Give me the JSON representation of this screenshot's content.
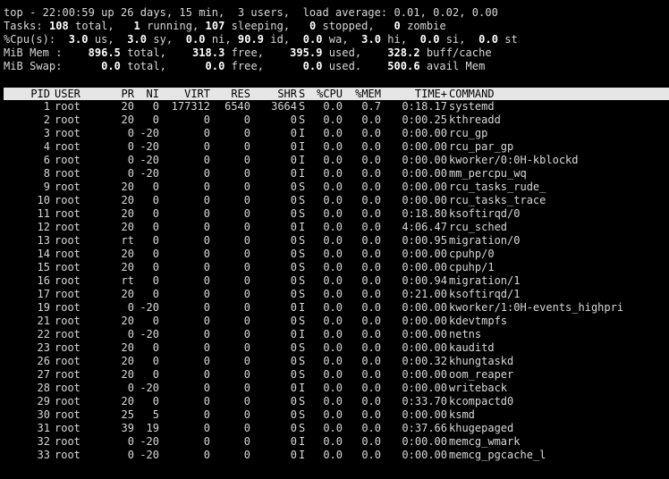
{
  "summary": {
    "uptime": {
      "prefix": "top - 22:00:59 up 26 days, 15 min,  3 users,  load average: 0.01, 0.02, 0.00"
    },
    "tasks": {
      "label": "Tasks: ",
      "total": "108",
      "total_label": " total,   ",
      "running": "1",
      "running_label": " running, ",
      "sleeping": "107",
      "sleeping_label": " sleeping,   ",
      "stopped": "0",
      "stopped_label": " stopped,   ",
      "zombie": "0",
      "zombie_label": " zombie"
    },
    "cpu": {
      "label": "%Cpu(s):  ",
      "us": "3.0",
      "us_label": " us,  ",
      "sy": "3.0",
      "sy_label": " sy,  ",
      "ni": "0.0",
      "ni_label": " ni, ",
      "id": "90.9",
      "id_label": " id,  ",
      "wa": "0.0",
      "wa_label": " wa,  ",
      "hi": "3.0",
      "hi_label": " hi,  ",
      "si": "0.0",
      "si_label": " si,  ",
      "st": "0.0",
      "st_label": " st"
    },
    "mem": {
      "label": "MiB Mem :    ",
      "total": "896.5",
      "total_label": " total,    ",
      "free": "318.3",
      "free_label": " free,    ",
      "used": "395.9",
      "used_label": " used,    ",
      "buff": "328.2",
      "buff_label": " buff/cache"
    },
    "swap": {
      "label": "MiB Swap:      ",
      "total": "0.0",
      "total_label": " total,      ",
      "free": "0.0",
      "free_label": " free,      ",
      "used": "0.0",
      "used_label": " used.    ",
      "avail": "500.6",
      "avail_label": " avail Mem"
    }
  },
  "header": {
    "pid": "PID",
    "user": "USER",
    "pr": "PR",
    "ni": "NI",
    "virt": "VIRT",
    "res": "RES",
    "shr": "SHR",
    "s": "S",
    "cpu": "%CPU",
    "mem": "%MEM",
    "time": "TIME+",
    "cmd": "COMMAND"
  },
  "processes": [
    {
      "pid": "1",
      "user": "root",
      "pr": "20",
      "ni": "0",
      "virt": "177312",
      "res": "6540",
      "shr": "3664",
      "s": "S",
      "cpu": "0.0",
      "mem": "0.7",
      "time": "0:18.17",
      "cmd": "systemd"
    },
    {
      "pid": "2",
      "user": "root",
      "pr": "20",
      "ni": "0",
      "virt": "0",
      "res": "0",
      "shr": "0",
      "s": "S",
      "cpu": "0.0",
      "mem": "0.0",
      "time": "0:00.25",
      "cmd": "kthreadd"
    },
    {
      "pid": "3",
      "user": "root",
      "pr": "0",
      "ni": "-20",
      "virt": "0",
      "res": "0",
      "shr": "0",
      "s": "I",
      "cpu": "0.0",
      "mem": "0.0",
      "time": "0:00.00",
      "cmd": "rcu_gp"
    },
    {
      "pid": "4",
      "user": "root",
      "pr": "0",
      "ni": "-20",
      "virt": "0",
      "res": "0",
      "shr": "0",
      "s": "I",
      "cpu": "0.0",
      "mem": "0.0",
      "time": "0:00.00",
      "cmd": "rcu_par_gp"
    },
    {
      "pid": "6",
      "user": "root",
      "pr": "0",
      "ni": "-20",
      "virt": "0",
      "res": "0",
      "shr": "0",
      "s": "I",
      "cpu": "0.0",
      "mem": "0.0",
      "time": "0:00.00",
      "cmd": "kworker/0:0H-kblockd"
    },
    {
      "pid": "8",
      "user": "root",
      "pr": "0",
      "ni": "-20",
      "virt": "0",
      "res": "0",
      "shr": "0",
      "s": "I",
      "cpu": "0.0",
      "mem": "0.0",
      "time": "0:00.00",
      "cmd": "mm_percpu_wq"
    },
    {
      "pid": "9",
      "user": "root",
      "pr": "20",
      "ni": "0",
      "virt": "0",
      "res": "0",
      "shr": "0",
      "s": "S",
      "cpu": "0.0",
      "mem": "0.0",
      "time": "0:00.00",
      "cmd": "rcu_tasks_rude_"
    },
    {
      "pid": "10",
      "user": "root",
      "pr": "20",
      "ni": "0",
      "virt": "0",
      "res": "0",
      "shr": "0",
      "s": "S",
      "cpu": "0.0",
      "mem": "0.0",
      "time": "0:00.00",
      "cmd": "rcu_tasks_trace"
    },
    {
      "pid": "11",
      "user": "root",
      "pr": "20",
      "ni": "0",
      "virt": "0",
      "res": "0",
      "shr": "0",
      "s": "S",
      "cpu": "0.0",
      "mem": "0.0",
      "time": "0:18.80",
      "cmd": "ksoftirqd/0"
    },
    {
      "pid": "12",
      "user": "root",
      "pr": "20",
      "ni": "0",
      "virt": "0",
      "res": "0",
      "shr": "0",
      "s": "I",
      "cpu": "0.0",
      "mem": "0.0",
      "time": "4:06.47",
      "cmd": "rcu_sched"
    },
    {
      "pid": "13",
      "user": "root",
      "pr": "rt",
      "ni": "0",
      "virt": "0",
      "res": "0",
      "shr": "0",
      "s": "S",
      "cpu": "0.0",
      "mem": "0.0",
      "time": "0:00.95",
      "cmd": "migration/0"
    },
    {
      "pid": "14",
      "user": "root",
      "pr": "20",
      "ni": "0",
      "virt": "0",
      "res": "0",
      "shr": "0",
      "s": "S",
      "cpu": "0.0",
      "mem": "0.0",
      "time": "0:00.00",
      "cmd": "cpuhp/0"
    },
    {
      "pid": "15",
      "user": "root",
      "pr": "20",
      "ni": "0",
      "virt": "0",
      "res": "0",
      "shr": "0",
      "s": "S",
      "cpu": "0.0",
      "mem": "0.0",
      "time": "0:00.00",
      "cmd": "cpuhp/1"
    },
    {
      "pid": "16",
      "user": "root",
      "pr": "rt",
      "ni": "0",
      "virt": "0",
      "res": "0",
      "shr": "0",
      "s": "S",
      "cpu": "0.0",
      "mem": "0.0",
      "time": "0:00.94",
      "cmd": "migration/1"
    },
    {
      "pid": "17",
      "user": "root",
      "pr": "20",
      "ni": "0",
      "virt": "0",
      "res": "0",
      "shr": "0",
      "s": "S",
      "cpu": "0.0",
      "mem": "0.0",
      "time": "0:21.00",
      "cmd": "ksoftirqd/1"
    },
    {
      "pid": "19",
      "user": "root",
      "pr": "0",
      "ni": "-20",
      "virt": "0",
      "res": "0",
      "shr": "0",
      "s": "I",
      "cpu": "0.0",
      "mem": "0.0",
      "time": "0:00.00",
      "cmd": "kworker/1:0H-events_highpri"
    },
    {
      "pid": "21",
      "user": "root",
      "pr": "20",
      "ni": "0",
      "virt": "0",
      "res": "0",
      "shr": "0",
      "s": "S",
      "cpu": "0.0",
      "mem": "0.0",
      "time": "0:00.00",
      "cmd": "kdevtmpfs"
    },
    {
      "pid": "22",
      "user": "root",
      "pr": "0",
      "ni": "-20",
      "virt": "0",
      "res": "0",
      "shr": "0",
      "s": "I",
      "cpu": "0.0",
      "mem": "0.0",
      "time": "0:00.00",
      "cmd": "netns"
    },
    {
      "pid": "23",
      "user": "root",
      "pr": "20",
      "ni": "0",
      "virt": "0",
      "res": "0",
      "shr": "0",
      "s": "S",
      "cpu": "0.0",
      "mem": "0.0",
      "time": "0:00.00",
      "cmd": "kauditd"
    },
    {
      "pid": "26",
      "user": "root",
      "pr": "20",
      "ni": "0",
      "virt": "0",
      "res": "0",
      "shr": "0",
      "s": "S",
      "cpu": "0.0",
      "mem": "0.0",
      "time": "0:00.32",
      "cmd": "khungtaskd"
    },
    {
      "pid": "27",
      "user": "root",
      "pr": "20",
      "ni": "0",
      "virt": "0",
      "res": "0",
      "shr": "0",
      "s": "S",
      "cpu": "0.0",
      "mem": "0.0",
      "time": "0:00.00",
      "cmd": "oom_reaper"
    },
    {
      "pid": "28",
      "user": "root",
      "pr": "0",
      "ni": "-20",
      "virt": "0",
      "res": "0",
      "shr": "0",
      "s": "I",
      "cpu": "0.0",
      "mem": "0.0",
      "time": "0:00.00",
      "cmd": "writeback"
    },
    {
      "pid": "29",
      "user": "root",
      "pr": "20",
      "ni": "0",
      "virt": "0",
      "res": "0",
      "shr": "0",
      "s": "S",
      "cpu": "0.0",
      "mem": "0.0",
      "time": "0:33.70",
      "cmd": "kcompactd0"
    },
    {
      "pid": "30",
      "user": "root",
      "pr": "25",
      "ni": "5",
      "virt": "0",
      "res": "0",
      "shr": "0",
      "s": "S",
      "cpu": "0.0",
      "mem": "0.0",
      "time": "0:00.00",
      "cmd": "ksmd"
    },
    {
      "pid": "31",
      "user": "root",
      "pr": "39",
      "ni": "19",
      "virt": "0",
      "res": "0",
      "shr": "0",
      "s": "S",
      "cpu": "0.0",
      "mem": "0.0",
      "time": "0:37.66",
      "cmd": "khugepaged"
    },
    {
      "pid": "32",
      "user": "root",
      "pr": "0",
      "ni": "-20",
      "virt": "0",
      "res": "0",
      "shr": "0",
      "s": "I",
      "cpu": "0.0",
      "mem": "0.0",
      "time": "0:00.00",
      "cmd": "memcg_wmark"
    },
    {
      "pid": "33",
      "user": "root",
      "pr": "0",
      "ni": "-20",
      "virt": "0",
      "res": "0",
      "shr": "0",
      "s": "I",
      "cpu": "0.0",
      "mem": "0.0",
      "time": "0:00.00",
      "cmd": "memcg_pgcache_l"
    }
  ]
}
